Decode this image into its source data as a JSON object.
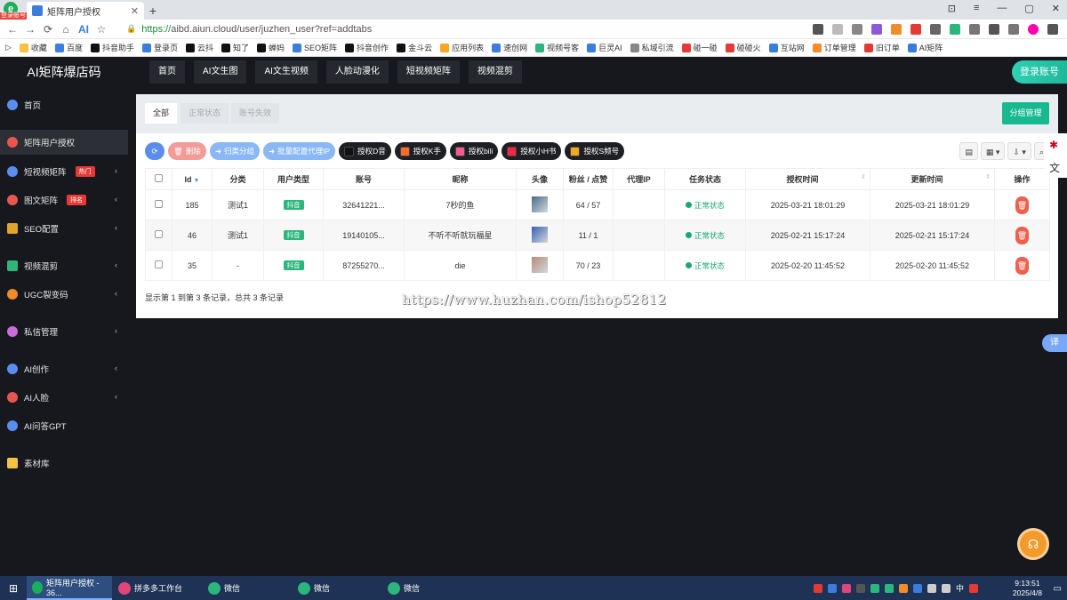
{
  "browser": {
    "app_badge": "登录账号",
    "tab_title": "矩阵用户授权",
    "url_scheme": "https://",
    "url_rest": "aibd.aiun.cloud/user/juzhen_user?ref=addtabs",
    "bookmarks": [
      "收藏",
      "百度",
      "抖音助手",
      "登录页",
      "云抖",
      "知了",
      "蝉妈",
      "SEO矩阵",
      "抖音创作",
      "金斗云",
      "应用列表",
      "速创网",
      "视频号客",
      "巨灵AI",
      "私域引流",
      "碰一碰",
      "碰碰火",
      "互站网",
      "订单管理",
      "旧订单",
      "AI矩阵"
    ]
  },
  "app": {
    "brand": "AI矩阵爆店码",
    "top_nav": [
      "首页",
      "AI文生图",
      "AI文生视频",
      "人脸动漫化",
      "短视频矩阵",
      "视频混剪"
    ],
    "login_button": "登录账号"
  },
  "sidebar": [
    {
      "label": "首页",
      "color": "#5b8def",
      "badge": "",
      "arrow": false
    },
    {
      "label": "矩阵用户授权",
      "color": "#e8574f",
      "badge": "",
      "arrow": false,
      "active": true
    },
    {
      "label": "短视频矩阵",
      "color": "#5b8def",
      "badge": "热门",
      "arrow": true
    },
    {
      "label": "图文矩阵",
      "color": "#e8574f",
      "badge": "排名",
      "arrow": true
    },
    {
      "label": "SEO配置",
      "color": "#e0a52a",
      "badge": "",
      "arrow": true
    },
    {
      "label": "视频混剪",
      "color": "#2cb67d",
      "badge": "",
      "arrow": true
    },
    {
      "label": "UGC裂变码",
      "color": "#f08a2b",
      "badge": "",
      "arrow": true
    },
    {
      "label": "私信管理",
      "color": "#c86dd7",
      "badge": "",
      "arrow": true
    },
    {
      "label": "AI创作",
      "color": "#5b8def",
      "badge": "",
      "arrow": true
    },
    {
      "label": "AI人脸",
      "color": "#e8574f",
      "badge": "",
      "arrow": true
    },
    {
      "label": "AI问答GPT",
      "color": "#5b8def",
      "badge": "",
      "arrow": false
    },
    {
      "label": "素材库",
      "color": "#f5c242",
      "badge": "",
      "arrow": false
    }
  ],
  "filter_tabs": [
    "全部",
    "正常状态",
    "账号失效"
  ],
  "group_button": "分组管理",
  "toolbar": {
    "delete": "删除",
    "classify": "归类分组",
    "proxy": "批量配置代理IP",
    "platforms": [
      {
        "label": "授权D音",
        "color": "#111"
      },
      {
        "label": "授权K手",
        "color": "#ff6a2a"
      },
      {
        "label": "授权bili",
        "color": "#f25d8e"
      },
      {
        "label": "授权小H书",
        "color": "#ff2442"
      },
      {
        "label": "授权S频号",
        "color": "#f5a623"
      }
    ]
  },
  "table": {
    "headers": [
      "Id",
      "分类",
      "用户类型",
      "账号",
      "昵称",
      "头像",
      "粉丝 / 点赞",
      "代理IP",
      "任务状态",
      "授权时间",
      "更新时间",
      "操作"
    ],
    "rows": [
      {
        "id": "185",
        "category": "测试1",
        "type": "抖音",
        "account": "32641221...",
        "nickname": "7秒的鱼",
        "avatar_color": "#4d6b8a",
        "fans": "64 / 57",
        "proxy": "",
        "status": "正常状态",
        "auth_time": "2025-03-21 18:01:29",
        "update_time": "2025-03-21 18:01:29"
      },
      {
        "id": "46",
        "category": "测试1",
        "type": "抖音",
        "account": "19140105...",
        "nickname": "不听不听就玩福星",
        "avatar_color": "#3b5fb0",
        "fans": "11 / 1",
        "proxy": "",
        "status": "正常状态",
        "auth_time": "2025-02-21 15:17:24",
        "update_time": "2025-02-21 15:17:24"
      },
      {
        "id": "35",
        "category": "-",
        "type": "抖音",
        "account": "87255270...",
        "nickname": "die",
        "avatar_color": "#b98a7a",
        "fans": "70 / 23",
        "proxy": "",
        "status": "正常状态",
        "auth_time": "2025-02-20 11:45:52",
        "update_time": "2025-02-20 11:45:52"
      }
    ],
    "summary": "显示第 1 到第 3 条记录，总共 3 条记录"
  },
  "watermark": "https://www.huzhan.com/ishop52812",
  "translate_label": "译",
  "taskbar": {
    "tasks": [
      "矩阵用户授权 - 36...",
      "拼多多工作台",
      "微信",
      "微信",
      "微信"
    ],
    "tray_lang": "中",
    "time": "9:13:51",
    "date": "2025/4/8"
  }
}
